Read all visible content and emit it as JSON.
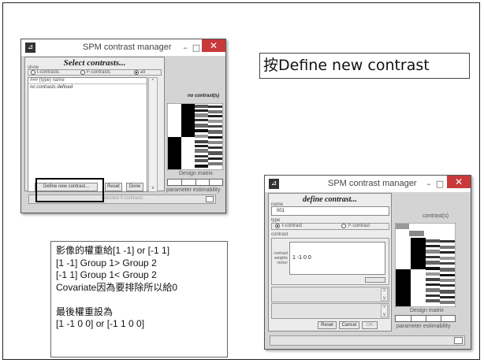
{
  "win1": {
    "title": "SPM contrast manager",
    "minimize": "–",
    "maximize": "□",
    "close": "✕",
    "heading": "Select contrasts...",
    "show_label": "show",
    "radio_t": "t-contrasts",
    "radio_f": "F-contrasts",
    "radio_all": "all",
    "list_header": "### {type}  name",
    "list_empty": "no contrasts defined",
    "contrasts_label": "no contrast(s)",
    "design_matrix_label": "Design matrix",
    "param_est_label": "parameter estimability",
    "define_button": "Define new contrast...",
    "reset_button": "Reset",
    "done_button": "Done",
    "status": "selected 0 contrasts"
  },
  "callout1": "按Define new contrast",
  "win2": {
    "title": "SPM contrast manager",
    "minimize": "–",
    "maximize": "□",
    "close": "✕",
    "heading": "define contrast...",
    "name_label": "name",
    "name_value": "001",
    "type_label": "type",
    "radio_t": "t-contrast",
    "radio_f": "F-contrast",
    "contrast_label": "contrast",
    "weights_label": "contrast weights vector",
    "weights_value": "1 -1 0 0",
    "contrasts_label": "contrast(s)",
    "design_matrix_label": "Design matrix",
    "param_est_label": "parameter estimability",
    "reset_button": "Reset",
    "cancel_button": "Cancel",
    "ok_button": "OK"
  },
  "note": {
    "lines": [
      "影像的權重給[1 -1] or [-1 1]",
      "[1 -1] Group 1> Group 2",
      "[-1 1] Group 1< Group 2",
      "Covariate因為要排除所以給0",
      "",
      "最後權重設為",
      "[1 -1 0 0] or [-1 1 0 0]"
    ]
  }
}
